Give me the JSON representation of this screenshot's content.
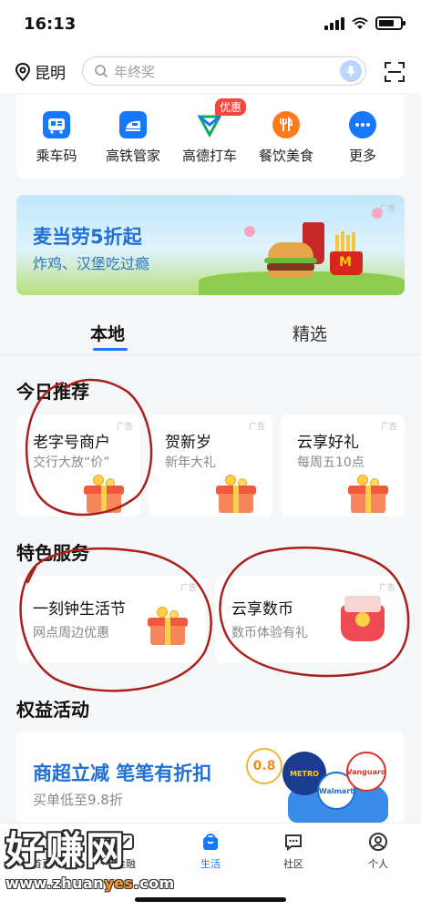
{
  "status": {
    "time": "16:13"
  },
  "header": {
    "location": "昆明",
    "search_placeholder": "年终奖"
  },
  "quick": [
    {
      "label": "乘车码",
      "color": "#1677ff"
    },
    {
      "label": "高铁管家",
      "color": "#1677ff"
    },
    {
      "label": "高德打车",
      "color": "#12a862",
      "badge": "优惠"
    },
    {
      "label": "餐饮美食",
      "color": "#ff7a1a"
    },
    {
      "label": "更多",
      "color": "#1677ff"
    }
  ],
  "banner": {
    "title": "麦当劳5折起",
    "subtitle": "炸鸡、汉堡吃过瘾",
    "ad": "广告"
  },
  "tabs": [
    {
      "label": "本地"
    },
    {
      "label": "精选"
    }
  ],
  "recommend": {
    "title": "今日推荐",
    "cards": [
      {
        "title": "老字号商户",
        "subtitle": "交行大放“价”",
        "ad": "广告"
      },
      {
        "title": "贺新岁",
        "subtitle": "新年大礼",
        "ad": "广告"
      },
      {
        "title": "云享好礼",
        "subtitle": "每周五10点",
        "ad": "广告"
      }
    ]
  },
  "services": {
    "title": "特色服务",
    "cards": [
      {
        "title": "一刻钟生活节",
        "subtitle": "网点周边优惠",
        "ad": "广告"
      },
      {
        "title": "云享数币",
        "subtitle": "数币体验有礼",
        "ad": "广告"
      }
    ]
  },
  "benefits": {
    "title": "权益活动",
    "card": {
      "title": "商超立减 笔笔有折扣",
      "subtitle": "买单低至9.8折",
      "logos": [
        "METRO",
        "Walmart",
        "Vanguard"
      ]
    }
  },
  "nav": [
    {
      "label": "首页"
    },
    {
      "label": "金融"
    },
    {
      "label": "生活",
      "active": true
    },
    {
      "label": "社区"
    },
    {
      "label": "个人"
    }
  ],
  "watermark": {
    "text": "好赚网",
    "url_pre": "www.zhuan",
    "url_hl": "yes",
    "url_post": ".com"
  },
  "colors": {
    "accent": "#1677ff",
    "annotation": "#a8211d"
  }
}
